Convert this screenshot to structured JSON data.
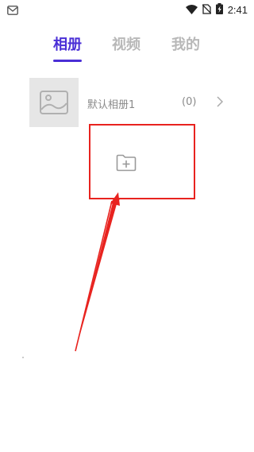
{
  "status_bar": {
    "time": "2:41",
    "icons": [
      "notification-icon",
      "wifi-icon",
      "no-sim-icon",
      "battery-charging-icon"
    ]
  },
  "tabs": [
    {
      "label": "相册",
      "active": true
    },
    {
      "label": "视频",
      "active": false
    },
    {
      "label": "我的",
      "active": false
    }
  ],
  "albums": [
    {
      "name": "默认相册1",
      "count": "(0)",
      "icon": "image-placeholder-icon"
    }
  ],
  "add_album": {
    "icon": "folder-add-icon"
  },
  "colors": {
    "accent": "#4a2fd6",
    "inactive_tab": "#b8b8b8",
    "annotation": "#e8231f",
    "thumb_bg": "#e6e6e6"
  }
}
